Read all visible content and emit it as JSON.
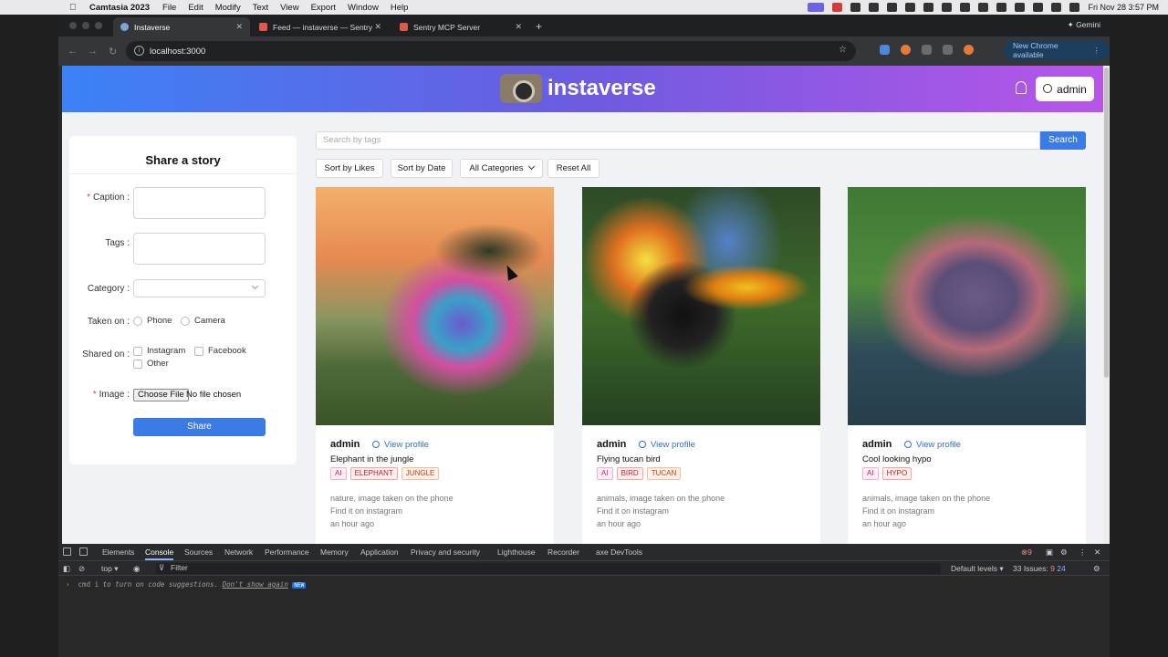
{
  "menubar": {
    "app_name": "Camtasia 2023",
    "items": [
      "File",
      "Edit",
      "Modify",
      "Text",
      "View",
      "Export",
      "Window",
      "Help"
    ],
    "datetime": "Fri Nov 28  3:57 PM"
  },
  "browser": {
    "tabs": [
      {
        "title": "Instaverse",
        "active": true
      },
      {
        "title": "Feed — instaverse — Sentry",
        "active": false
      },
      {
        "title": "Sentry MCP Server",
        "active": false
      }
    ],
    "gemini_label": "Gemini",
    "url": "localhost:3000",
    "new_chrome_label": "New Chrome available"
  },
  "app": {
    "brand": "instaverse",
    "user_button": "admin",
    "accent_color": "#3b7be6"
  },
  "share_form": {
    "title": "Share a story",
    "caption_label": "Caption",
    "tags_label": "Tags",
    "category_label": "Category",
    "taken_on_label": "Taken on",
    "taken_on_options": [
      "Phone",
      "Camera"
    ],
    "shared_on_label": "Shared on",
    "shared_on_options": [
      "Instagram",
      "Facebook",
      "Other"
    ],
    "image_label": "Image",
    "file_button": "Choose File",
    "file_status": "No file chosen",
    "submit_label": "Share"
  },
  "feed": {
    "search_placeholder": "Search by tags",
    "search_button": "Search",
    "sort_likes": "Sort by Likes",
    "sort_date": "Sort by Date",
    "categories": "All Categories",
    "reset": "Reset All",
    "view_profile": "View profile",
    "posts": [
      {
        "user": "admin",
        "caption": "Elephant in the jungle",
        "tags": [
          "AI",
          "ELEPHANT",
          "JUNGLE"
        ],
        "meta": "nature, image taken on the phone",
        "shared": "Find it on instagram",
        "time": "an hour ago"
      },
      {
        "user": "admin",
        "caption": "Flying tucan bird",
        "tags": [
          "AI",
          "BIRD",
          "TUCAN"
        ],
        "meta": "animals, image taken on the phone",
        "shared": "Find it on instagram",
        "time": "an hour ago"
      },
      {
        "user": "admin",
        "caption": "Cool looking hypo",
        "tags": [
          "AI",
          "HYPO"
        ],
        "meta": "animals, image taken on the phone",
        "shared": "Find it on instagram",
        "time": "an hour ago"
      }
    ]
  },
  "devtools": {
    "tabs": [
      "Elements",
      "Console",
      "Sources",
      "Network",
      "Performance",
      "Memory",
      "Application",
      "Privacy and security",
      "Lighthouse",
      "Recorder",
      "axe DevTools"
    ],
    "active_tab": "Console",
    "error_count": "9",
    "context": "top",
    "filter_placeholder": "Filter",
    "levels": "Default levels",
    "issues": "33 Issues:",
    "issues_errors": "9",
    "issues_info": "24",
    "hint_key": "cmd",
    "hint_key2": "i",
    "hint_text": "to turn on code suggestions.",
    "hint_link": "Don't show again",
    "hint_badge": "NEW"
  }
}
